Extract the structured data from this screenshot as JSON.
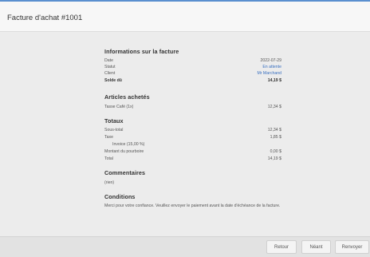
{
  "header": {
    "title": "Facture d'achat #1001"
  },
  "info": {
    "title": "Informations sur la facture",
    "rows": [
      {
        "label": "Date",
        "value": "2022-07-29"
      },
      {
        "label": "Statut",
        "value": "En attente"
      },
      {
        "label": "Client",
        "value": "Mr Marchand"
      },
      {
        "label": "Solde dû",
        "value": "14,19 $"
      }
    ]
  },
  "items": {
    "title": "Articles achetés",
    "rows": [
      {
        "label": "Tasse Café (1x)",
        "value": "12,34 $"
      }
    ]
  },
  "totals": {
    "title": "Totaux",
    "rows": [
      {
        "label": "Sous-total",
        "value": "12,34 $"
      },
      {
        "label": "Taxe",
        "value": "1,85 $"
      },
      {
        "label": "Invoice (15,00 %)",
        "value": ""
      },
      {
        "label": "Montant du pourboire",
        "value": "0,00 $"
      },
      {
        "label": "Total",
        "value": "14,19 $"
      }
    ]
  },
  "comments": {
    "title": "Commentaires",
    "text": "(rien)"
  },
  "conditions": {
    "title": "Conditions",
    "text": "Merci pour votre confiance. Veuillez envoyer le paiement avant la date d'échéance de la facture."
  },
  "footer": {
    "back_label": "Retour",
    "cancel_label": "Néant",
    "resend_label": "Renvoyer"
  },
  "colors": {
    "accent": "#5a8fcf",
    "link": "#3a70c0"
  }
}
